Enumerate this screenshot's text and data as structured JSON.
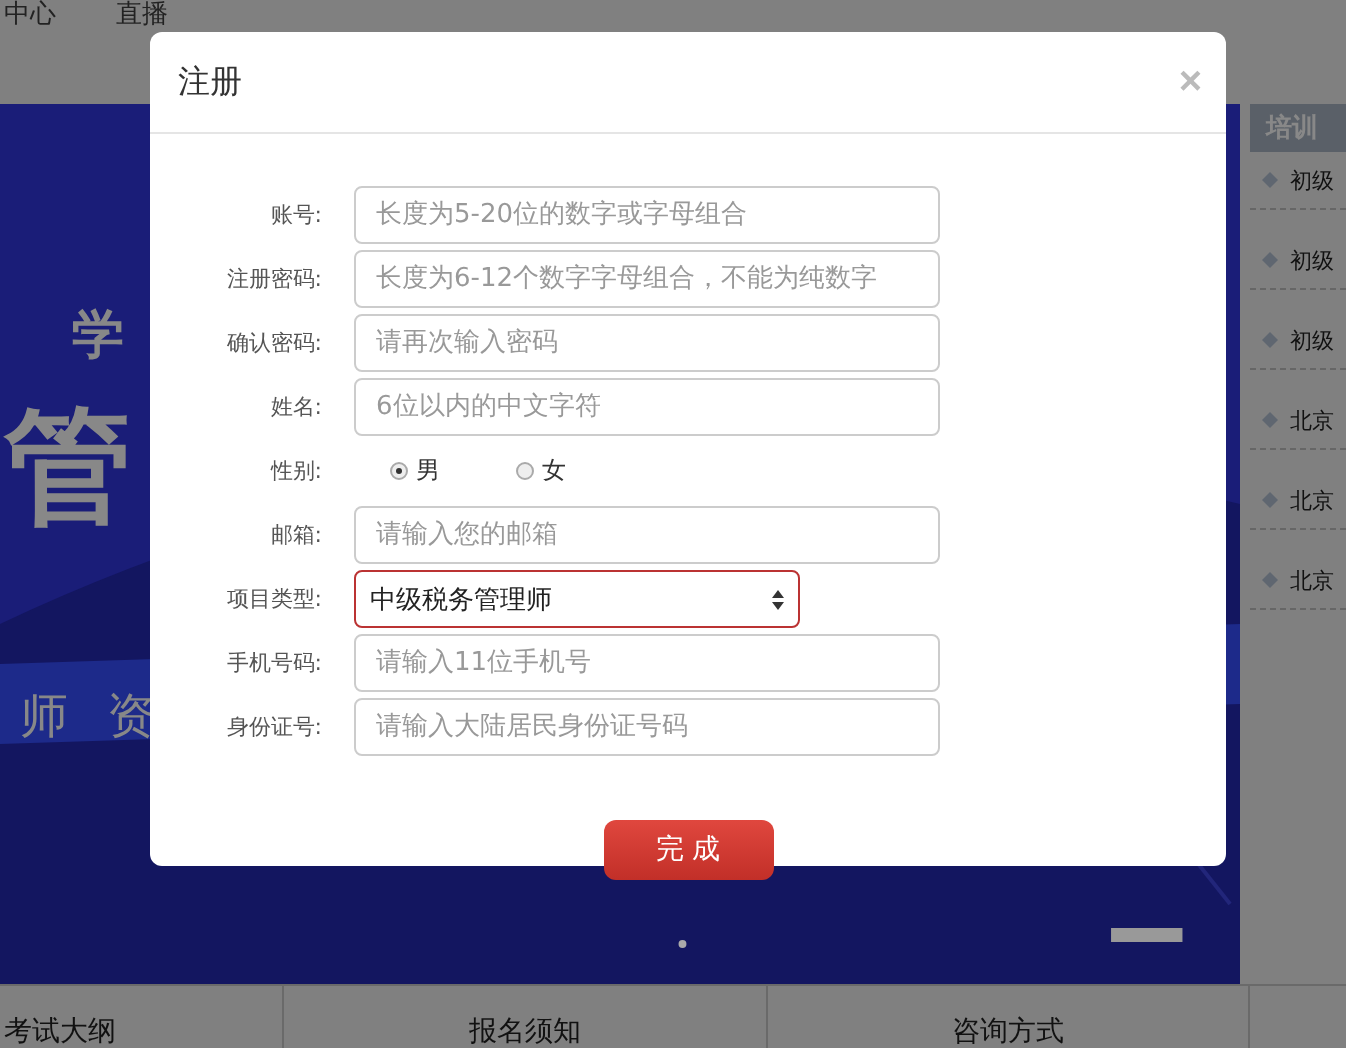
{
  "nav": [
    "中心",
    "直播"
  ],
  "banner": {
    "kind": "picture",
    "texts": [
      "学",
      "管",
      "师 资"
    ]
  },
  "sidebar": {
    "title": "培训",
    "items": [
      "初级",
      "初级",
      "初级",
      "北京",
      "北京",
      "北京"
    ]
  },
  "bottom_tabs": [
    "考试大纲",
    "报名须知",
    "咨询方式"
  ],
  "dialog": {
    "title": "注册",
    "close": "×",
    "fields": [
      {
        "kind": "input",
        "label": "账号:",
        "placeholder": "长度为5-20位的数字或字母组合"
      },
      {
        "kind": "input",
        "label": "注册密码:",
        "placeholder": "长度为6-12个数字字母组合，不能为纯数字"
      },
      {
        "kind": "input",
        "label": "确认密码:",
        "placeholder": "请再次输入密码"
      },
      {
        "kind": "input",
        "label": "姓名:",
        "placeholder": "6位以内的中文字符"
      },
      {
        "kind": "radio",
        "label": "性别:",
        "options": [
          {
            "label": "男",
            "selected": true
          },
          {
            "label": "女",
            "selected": false
          }
        ]
      },
      {
        "kind": "input",
        "label": "邮箱:",
        "placeholder": "请输入您的邮箱"
      },
      {
        "kind": "select",
        "label": "项目类型:",
        "value": "中级税务管理师"
      },
      {
        "kind": "input",
        "label": "手机号码:",
        "placeholder": "请输入11位手机号"
      },
      {
        "kind": "input",
        "label": "身份证号:",
        "placeholder": "请输入大陆居民身份证号码"
      }
    ],
    "submit": "完 成"
  }
}
